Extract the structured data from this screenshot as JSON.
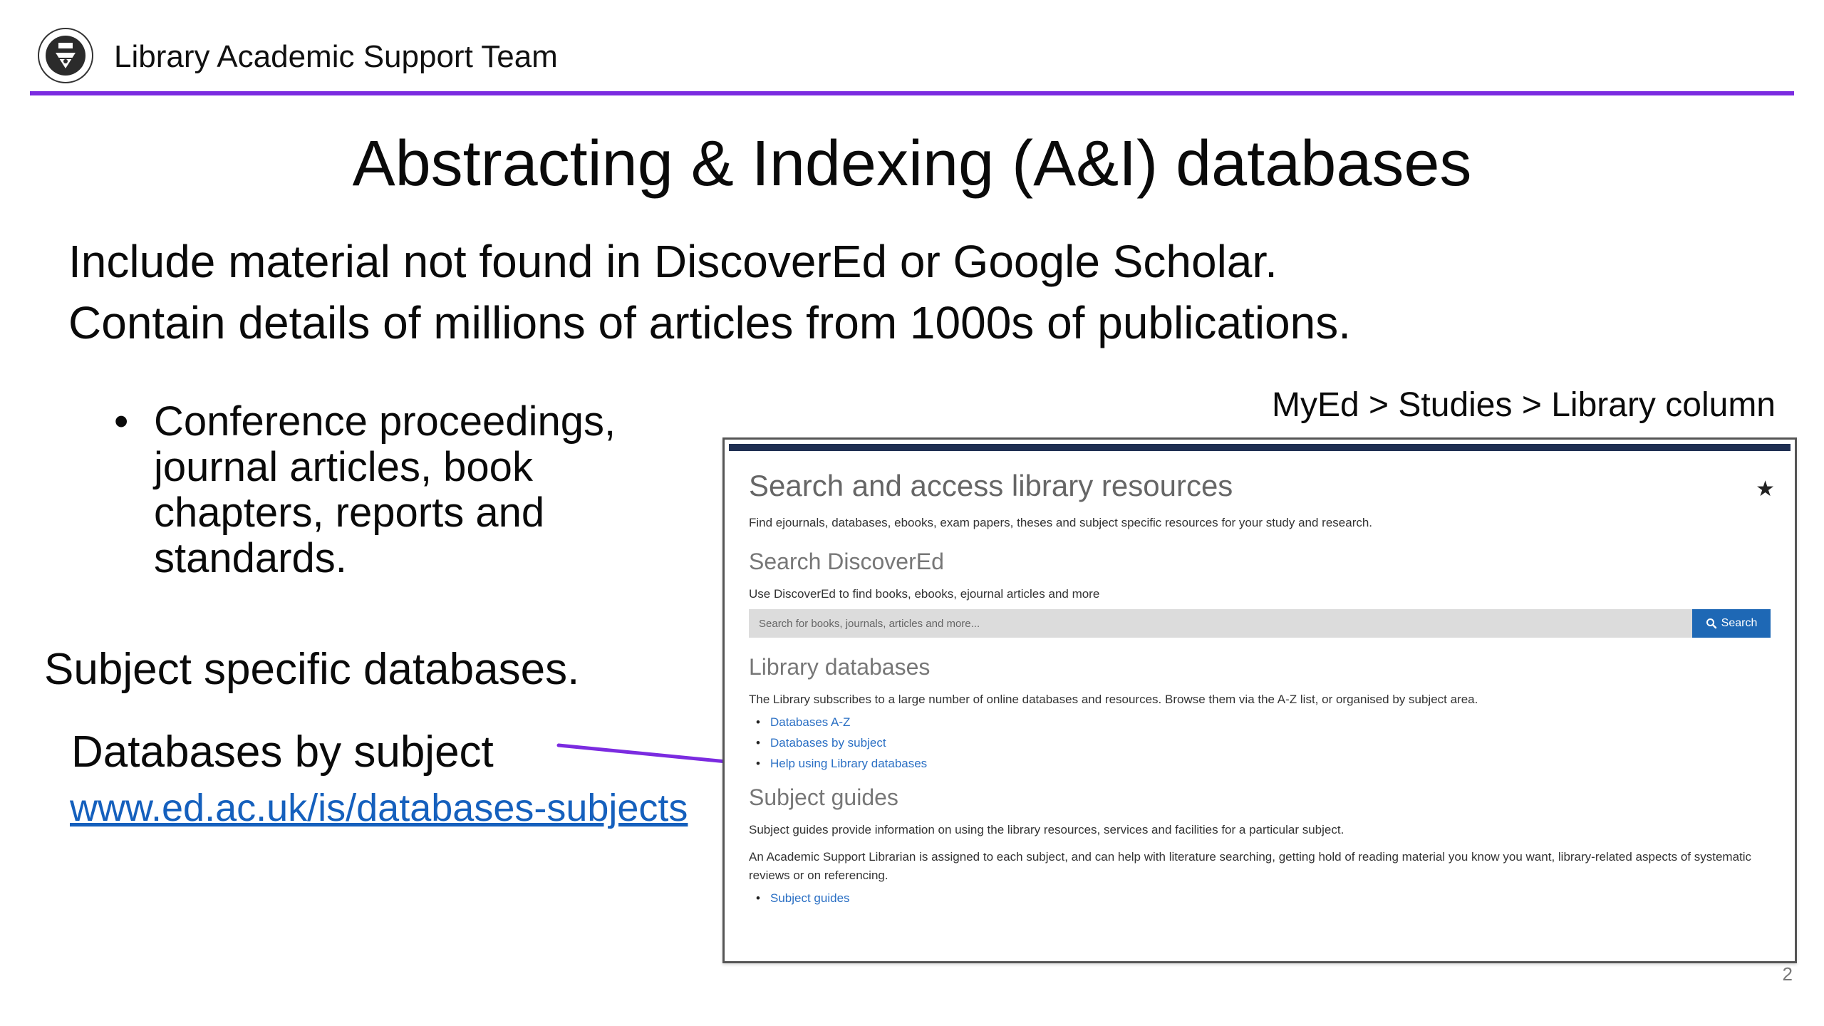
{
  "header": {
    "team": "Library Academic Support Team"
  },
  "slide": {
    "title": "Abstracting & Indexing (A&I) databases",
    "intro": [
      "Include material not found in DiscoverEd or Google Scholar.",
      "Contain details of millions of articles from 1000s of publications."
    ],
    "bullets": [
      "Conference proceedings, journal articles, book chapters, reports and standards."
    ],
    "subject_heading": "Subject specific databases.",
    "databases_by_subject": "Databases by subject",
    "link": "www.ed.ac.uk/is/databases-subjects",
    "nav_path": "MyEd > Studies > Library column",
    "page_number": "2",
    "arrow_color": "#7b2be0"
  },
  "panel": {
    "title": "Search and access library resources",
    "description": "Find ejournals, databases, ebooks, exam papers, theses and subject specific resources for your study and research.",
    "discovered_heading": "Search DiscoverEd",
    "discovered_text": "Use DiscoverEd to find books, ebooks, ejournal articles and more",
    "search_placeholder": "Search for books, journals, articles and more...",
    "search_button": "Search",
    "library_heading": "Library databases",
    "library_text": "The Library subscribes to a large number of online databases and resources. Browse them via the A-Z list, or organised by subject area.",
    "library_links": [
      "Databases A-Z",
      "Databases by subject",
      "Help using Library databases"
    ],
    "guides_heading": "Subject guides",
    "guides_text_1": "Subject guides provide information on using the library resources, services and facilities for a particular subject.",
    "guides_text_2": "An Academic Support Librarian is assigned to each subject, and can help with literature searching, getting hold of reading material you know you want, library-related aspects of systematic reviews or on referencing.",
    "guides_links": [
      "Subject guides"
    ]
  }
}
